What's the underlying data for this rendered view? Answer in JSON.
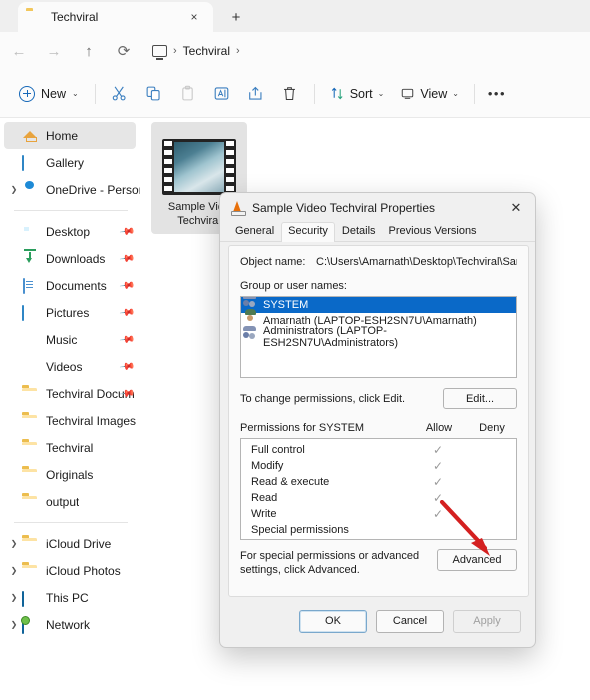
{
  "window": {
    "tab": {
      "label": "Techviral",
      "icon": "folder-icon",
      "close_icon": "×"
    },
    "new_tab_icon": "+",
    "nav": {
      "back_icon": "←",
      "forward_icon": "→",
      "up_icon": "↑",
      "refresh_icon": "⟳",
      "address": {
        "root_icon": "pc-icon",
        "sep": "›",
        "crumb": "Techviral",
        "sep2": "›"
      }
    },
    "toolbar": {
      "new_label": "New",
      "new_chevron": "⌄",
      "cut_label": "Cut",
      "copy_label": "Copy",
      "paste_label": "Paste",
      "rename_label": "Rename",
      "share_label": "Share",
      "delete_label": "Delete",
      "sort_label": "Sort",
      "sort_chevron": "⌄",
      "view_label": "View",
      "view_chevron": "⌄",
      "more_label": "•••"
    }
  },
  "sidebar": {
    "items": [
      {
        "label": "Home",
        "icon": "home-icon",
        "selected": true,
        "expander": false,
        "pinned": false
      },
      {
        "label": "Gallery",
        "icon": "gallery-icon",
        "selected": false,
        "expander": false,
        "pinned": false
      },
      {
        "label": "OneDrive - Persona",
        "icon": "onedrive-icon",
        "selected": false,
        "expander": true,
        "pinned": false
      }
    ],
    "pinned": [
      {
        "label": "Desktop",
        "icon": "desktop-icon",
        "pinned": true
      },
      {
        "label": "Downloads",
        "icon": "downloads-icon",
        "pinned": true
      },
      {
        "label": "Documents",
        "icon": "documents-icon",
        "pinned": true
      },
      {
        "label": "Pictures",
        "icon": "pictures-icon",
        "pinned": true
      },
      {
        "label": "Music",
        "icon": "music-icon",
        "pinned": true
      },
      {
        "label": "Videos",
        "icon": "videos-icon",
        "pinned": true
      },
      {
        "label": "Techviral Docum",
        "icon": "folder-icon",
        "pinned": true
      },
      {
        "label": "Techviral Images",
        "icon": "folder-icon",
        "pinned": false
      },
      {
        "label": "Techviral",
        "icon": "folder-icon",
        "pinned": false
      },
      {
        "label": "Originals",
        "icon": "folder-icon",
        "pinned": false
      },
      {
        "label": "output",
        "icon": "folder-icon",
        "pinned": false
      }
    ],
    "drives": [
      {
        "label": "iCloud Drive",
        "icon": "folder-icon",
        "expander": true
      },
      {
        "label": "iCloud Photos",
        "icon": "folder-icon",
        "expander": true
      },
      {
        "label": "This PC",
        "icon": "thispc-icon",
        "expander": true
      },
      {
        "label": "Network",
        "icon": "network-icon",
        "expander": true
      }
    ]
  },
  "content": {
    "file": {
      "name_line1": "Sample Vide",
      "name_line2": "Techviral",
      "icon": "video-thumbnail"
    }
  },
  "dialog": {
    "title": "Sample Video Techviral Properties",
    "title_icon": "vlc-icon",
    "close_icon": "✕",
    "tabs": [
      {
        "label": "General",
        "active": false
      },
      {
        "label": "Security",
        "active": true
      },
      {
        "label": "Details",
        "active": false
      },
      {
        "label": "Previous Versions",
        "active": false
      }
    ],
    "object_name_label": "Object name:",
    "object_name_value": "C:\\Users\\Amarnath\\Desktop\\Techviral\\Sample Vide",
    "group_label": "Group or user names:",
    "users": [
      {
        "name": "SYSTEM",
        "icon": "users-icon",
        "selected": true
      },
      {
        "name": "Amarnath (LAPTOP-ESH2SN7U\\Amarnath)",
        "icon": "user-icon",
        "selected": false
      },
      {
        "name": "Administrators (LAPTOP-ESH2SN7U\\Administrators)",
        "icon": "users-icon",
        "selected": false
      }
    ],
    "edit_hint": "To change permissions, click Edit.",
    "edit_button": "Edit...",
    "permissions_for": "Permissions for SYSTEM",
    "allow_header": "Allow",
    "deny_header": "Deny",
    "permissions": [
      {
        "name": "Full control",
        "allow": "✓",
        "deny": ""
      },
      {
        "name": "Modify",
        "allow": "✓",
        "deny": ""
      },
      {
        "name": "Read & execute",
        "allow": "✓",
        "deny": ""
      },
      {
        "name": "Read",
        "allow": "✓",
        "deny": ""
      },
      {
        "name": "Write",
        "allow": "✓",
        "deny": ""
      },
      {
        "name": "Special permissions",
        "allow": "",
        "deny": ""
      }
    ],
    "advanced_hint_line1": "For special permissions or advanced settings,",
    "advanced_hint_line2": "click Advanced.",
    "advanced_button": "Advanced",
    "ok_button": "OK",
    "cancel_button": "Cancel",
    "apply_button": "Apply"
  },
  "annotation": {
    "arrow_color": "#d42020",
    "points_to": "Advanced"
  },
  "colors": {
    "selection_blue": "#0a69c8",
    "accent_blue": "#1668b8",
    "titlebar": "#efefef",
    "dialog_bg": "#f0f0f0"
  }
}
